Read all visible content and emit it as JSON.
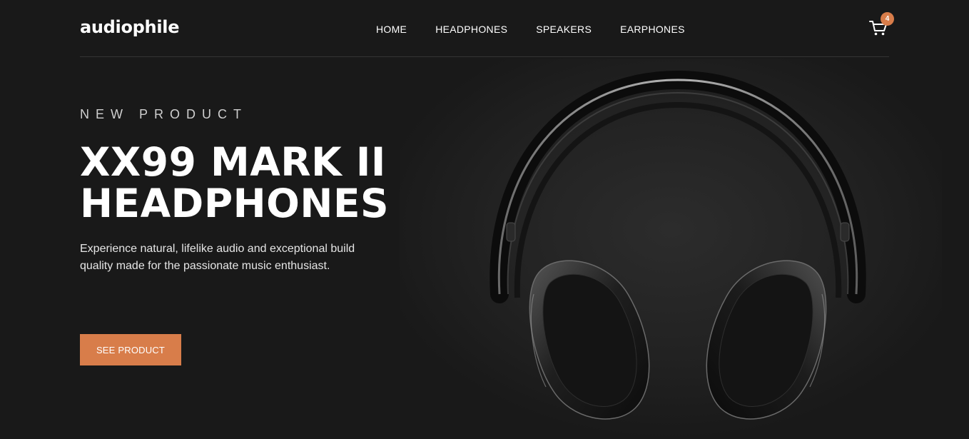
{
  "header": {
    "logo": "audiophile",
    "nav": [
      {
        "label": "HOME"
      },
      {
        "label": "HEADPHONES"
      },
      {
        "label": "SPEAKERS"
      },
      {
        "label": "EARPHONES"
      }
    ],
    "cart": {
      "icon": "cart-icon",
      "count": "4"
    }
  },
  "hero": {
    "eyebrow": "NEW PRODUCT",
    "title_line1": "XX99 MARK II",
    "title_line2": "HEADPHONES",
    "description": "Experience natural, lifelike audio and exceptional build quality made for the passionate music enthusiast.",
    "cta_label": "SEE PRODUCT",
    "image": "headphones-image"
  },
  "colors": {
    "background": "#191919",
    "accent": "#d87d4a",
    "text": "#ffffff"
  }
}
